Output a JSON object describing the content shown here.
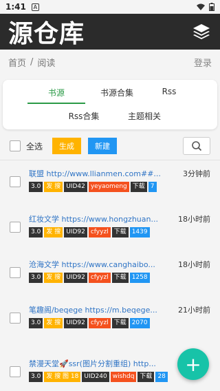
{
  "status": {
    "time": "1:41",
    "notif": "A"
  },
  "appbar": {
    "title": "源仓库"
  },
  "breadcrumb": {
    "home": "首页",
    "sep": "/",
    "current": "阅读",
    "login": "登录"
  },
  "tabs": [
    {
      "label": "书源",
      "active": true
    },
    {
      "label": "书源合集"
    },
    {
      "label": "Rss"
    },
    {
      "label": "Rss合集"
    },
    {
      "label": "主题相关"
    }
  ],
  "actions": {
    "select_all": "全选",
    "generate": "生成",
    "create": "新建"
  },
  "items": [
    {
      "name": "联盟 http://www.llianmen.com##...",
      "time": "3分钟前",
      "version": "3.0",
      "search": "发 搜",
      "uid": "UID42",
      "author": "yeyaomeng",
      "dl": "下载",
      "count": "7"
    },
    {
      "name": "红妆文学 https://www.hongzhuan...",
      "time": "18小时前",
      "version": "3.0",
      "search": "发 搜",
      "uid": "UID92",
      "author": "cfyyzl",
      "dl": "下载",
      "count": "1439"
    },
    {
      "name": "沧海文学 https://www.canghaibo...",
      "time": "18小时前",
      "version": "3.0",
      "search": "发 搜",
      "uid": "UID92",
      "author": "cfyyzl",
      "dl": "下载",
      "count": "1258"
    },
    {
      "name": "笔趣阁/beqege https://m.beqege...",
      "time": "21小时前",
      "version": "3.0",
      "search": "发 搜",
      "uid": "UID92",
      "author": "cfyyzl",
      "dl": "下载",
      "count": "2070"
    },
    {
      "name": "禁漫天堂🚀ssr(图片分割重组) http...",
      "time": "",
      "version": "3.0",
      "search": "发 搜 图 18",
      "uid": "UID240",
      "author": "wishdq",
      "dl": "下载",
      "count": "28"
    }
  ],
  "fab": {
    "label": "+"
  }
}
